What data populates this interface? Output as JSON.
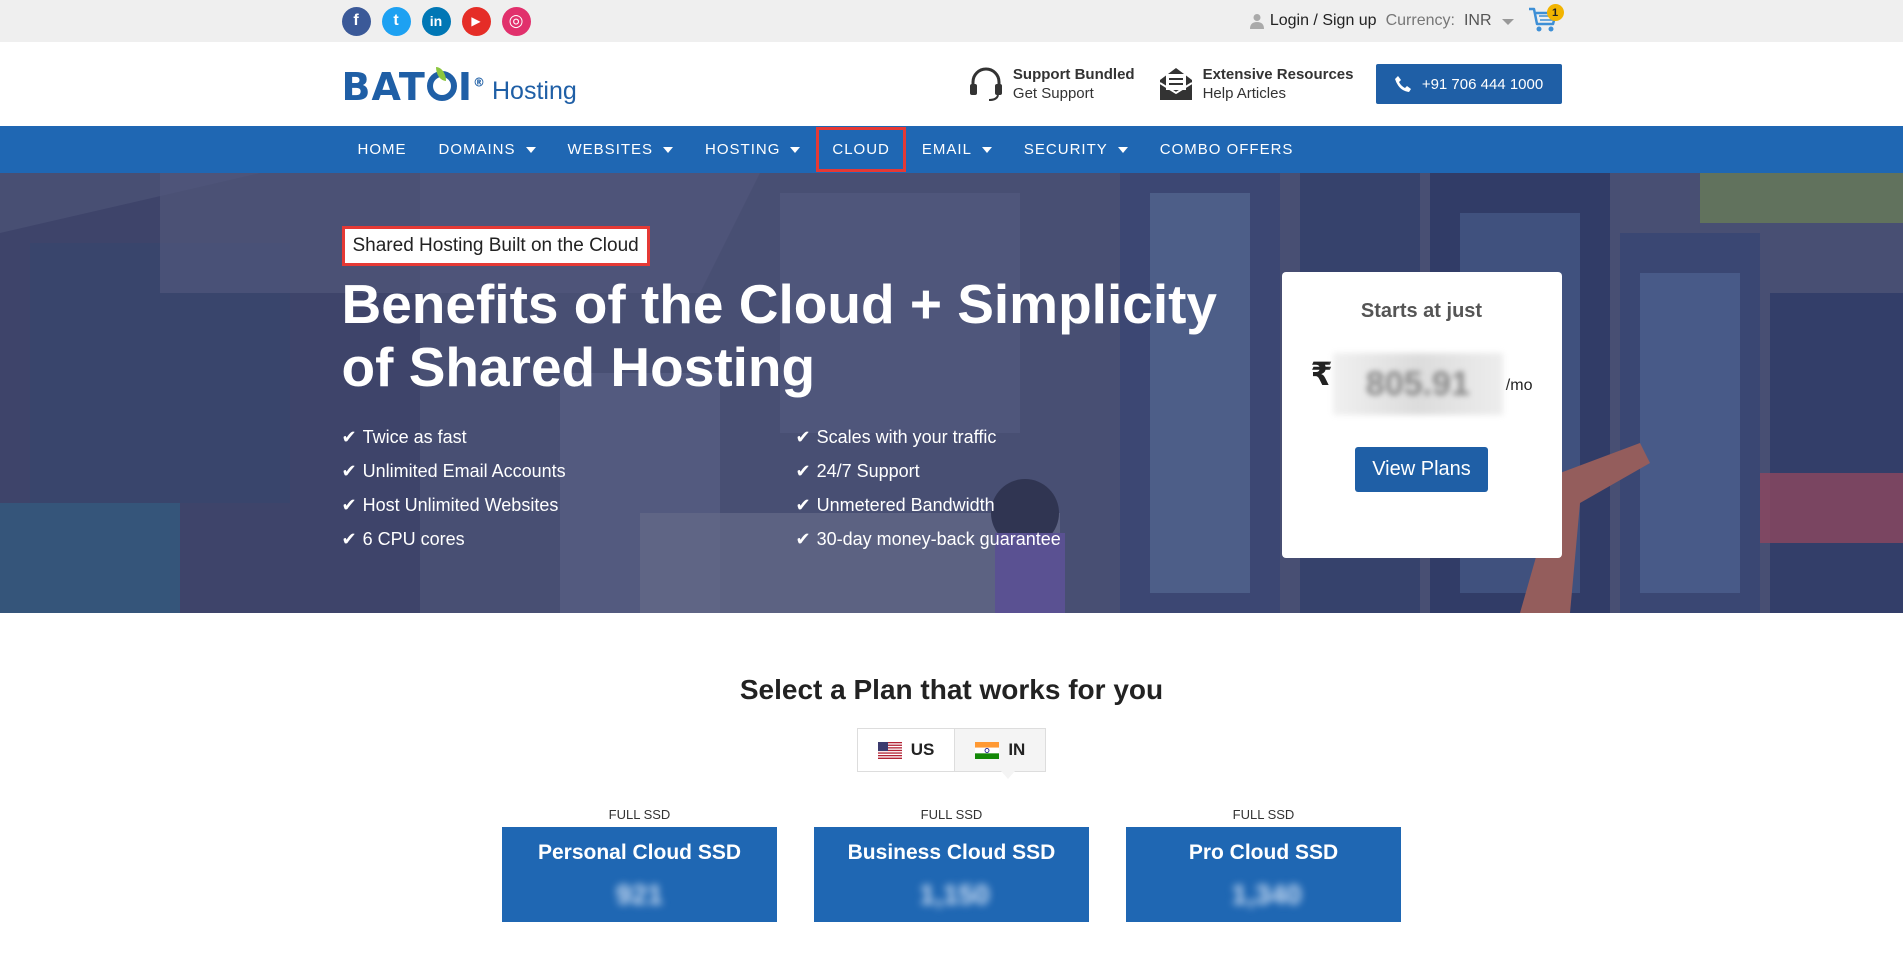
{
  "topbar": {
    "social": [
      {
        "name": "facebook-icon",
        "glyph": "f",
        "color": "#3b5998"
      },
      {
        "name": "twitter-icon",
        "glyph": "t",
        "color": "#1da1f2"
      },
      {
        "name": "linkedin-icon",
        "glyph": "in",
        "color": "#0077b5"
      },
      {
        "name": "youtube-icon",
        "glyph": "▶",
        "color": "#e52d27"
      },
      {
        "name": "instagram-icon",
        "glyph": "◎",
        "color": "#e1306c"
      }
    ],
    "login_label": "Login / Sign up",
    "currency_label": "Currency:",
    "currency_value": "INR",
    "cart_count": "1"
  },
  "header": {
    "brand": {
      "part1": "BAT",
      "part2": "I",
      "reg": "®",
      "sub": "Hosting"
    },
    "support": {
      "title": "Support Bundled",
      "subtitle": "Get Support"
    },
    "resources": {
      "title": "Extensive Resources",
      "subtitle": "Help Articles"
    },
    "phone": "+91 706 444 1000"
  },
  "nav": {
    "items": [
      {
        "label": "HOME",
        "dropdown": false
      },
      {
        "label": "DOMAINS",
        "dropdown": true
      },
      {
        "label": "WEBSITES",
        "dropdown": true
      },
      {
        "label": "HOSTING",
        "dropdown": true
      },
      {
        "label": "CLOUD",
        "dropdown": false,
        "active": true
      },
      {
        "label": "EMAIL",
        "dropdown": true
      },
      {
        "label": "SECURITY",
        "dropdown": true
      },
      {
        "label": "COMBO OFFERS",
        "dropdown": false
      }
    ]
  },
  "hero": {
    "tagline": "Shared Hosting Built on the Cloud",
    "title": "Benefits of the Cloud + Simplicity of Shared Hosting",
    "features": [
      "Twice as fast",
      "Scales with your traffic",
      "Unlimited Email Accounts",
      "24/7 Support",
      "Host Unlimited Websites",
      "Unmetered Bandwidth",
      "6 CPU cores",
      "30-day money-back guarantee"
    ],
    "price_card": {
      "starts": "Starts at just",
      "currency": "₹",
      "amount": "805.91",
      "per": "/mo",
      "button": "View Plans"
    }
  },
  "plans": {
    "heading": "Select a Plan that works for you",
    "countries": [
      {
        "code": "US"
      },
      {
        "code": "IN"
      }
    ],
    "cards": [
      {
        "badge": "FULL SSD",
        "name": "Personal Cloud SSD",
        "price": "921"
      },
      {
        "badge": "FULL SSD",
        "name": "Business Cloud SSD",
        "price": "1,150"
      },
      {
        "badge": "FULL SSD",
        "name": "Pro Cloud SSD",
        "price": "1,340"
      }
    ]
  }
}
